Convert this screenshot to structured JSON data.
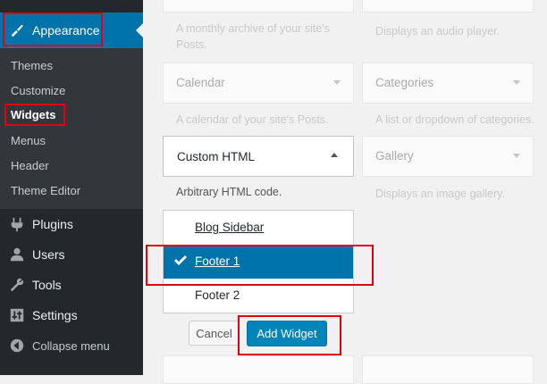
{
  "sidebar": {
    "current_menu": {
      "label": "Appearance",
      "icon": "paintbrush-icon"
    },
    "submenu": [
      "Themes",
      "Customize",
      "Widgets",
      "Menus",
      "Header",
      "Theme Editor"
    ],
    "submenu_current": "Widgets",
    "menu": [
      {
        "label": "Plugins",
        "icon": "plugin-icon"
      },
      {
        "label": "Users",
        "icon": "users-icon"
      },
      {
        "label": "Tools",
        "icon": "wrench-icon"
      },
      {
        "label": "Settings",
        "icon": "settings-icon"
      }
    ],
    "collapse_label": "Collapse menu"
  },
  "widgets": {
    "archives_desc": "A monthly archive of your site's Posts.",
    "audio_desc": "Displays an audio player.",
    "calendar": {
      "title": "Calendar",
      "desc": "A calendar of your site's Posts."
    },
    "categories": {
      "title": "Categories",
      "desc": "A list or dropdown of categories."
    },
    "custom_html": {
      "title": "Custom HTML",
      "desc": "Arbitrary HTML code."
    },
    "gallery": {
      "title": "Gallery",
      "desc": "Displays an image gallery."
    }
  },
  "sidebar_chooser": {
    "options": [
      "Blog Sidebar",
      "Footer 1",
      "Footer 2"
    ],
    "selected": "Footer 1"
  },
  "actions": {
    "cancel_label": "Cancel",
    "add_label": "Add Widget"
  },
  "colors": {
    "admin_bar": "#23282d",
    "submenu": "#32373c",
    "accent": "#0073aa",
    "highlight": "#e3000f"
  }
}
